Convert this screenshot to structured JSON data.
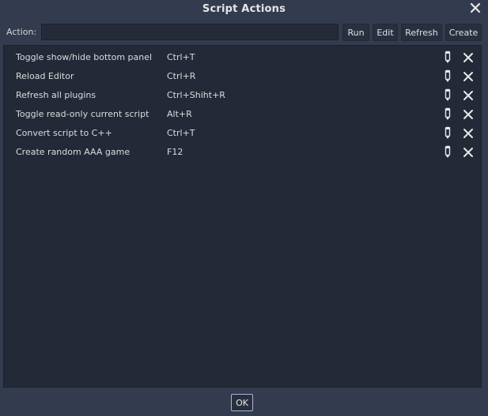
{
  "window": {
    "title": "Script Actions",
    "close_icon": "close-icon"
  },
  "toolbar": {
    "action_label": "Action:",
    "action_value": "",
    "action_placeholder": "",
    "run_label": "Run",
    "edit_label": "Edit",
    "refresh_label": "Refresh",
    "create_label": "Create"
  },
  "actions": [
    {
      "name": "Toggle show/hide bottom panel",
      "shortcut": "Ctrl+T"
    },
    {
      "name": "Reload Editor",
      "shortcut": "Ctrl+R"
    },
    {
      "name": "Refresh all plugins",
      "shortcut": "Ctrl+Shiht+R"
    },
    {
      "name": "Toggle read-only current script",
      "shortcut": "Alt+R"
    },
    {
      "name": "Convert script to C++",
      "shortcut": "Ctrl+T"
    },
    {
      "name": "Create random AAA game",
      "shortcut": "F12"
    }
  ],
  "footer": {
    "ok_label": "OK"
  },
  "colors": {
    "background": "#333b4f",
    "panel": "#232937",
    "text": "#e0e0e0",
    "ok_border": "#a9b6d0"
  }
}
